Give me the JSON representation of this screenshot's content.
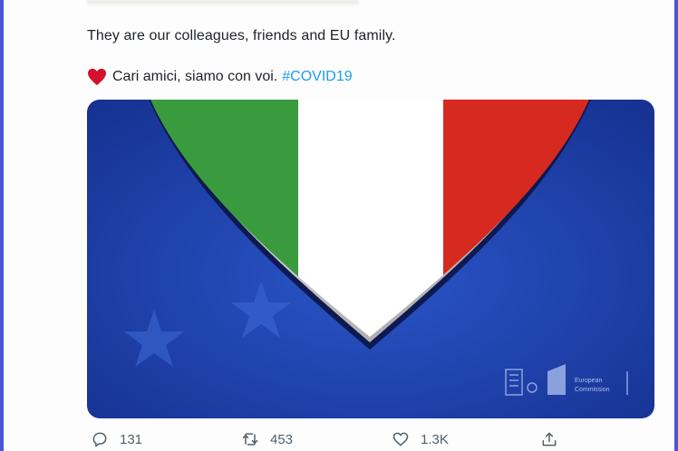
{
  "tweet": {
    "line1": "They are our colleagues, friends and EU family.",
    "line2_text": "Cari amici, siamo con voi.",
    "hashtag": "#COVID19"
  },
  "media": {
    "logo_line1": "European",
    "logo_line2": "Commission",
    "colors": {
      "blue": "#1c3fa8",
      "green": "#3a9b3e",
      "white": "#ffffff",
      "red": "#d6291f"
    }
  },
  "actions": {
    "reply_count": "131",
    "retweet_count": "453",
    "like_count": "1.3K"
  },
  "icons": [
    "heart-emoji-icon",
    "reply-icon",
    "retweet-icon",
    "like-icon",
    "share-icon",
    "star-icon"
  ]
}
